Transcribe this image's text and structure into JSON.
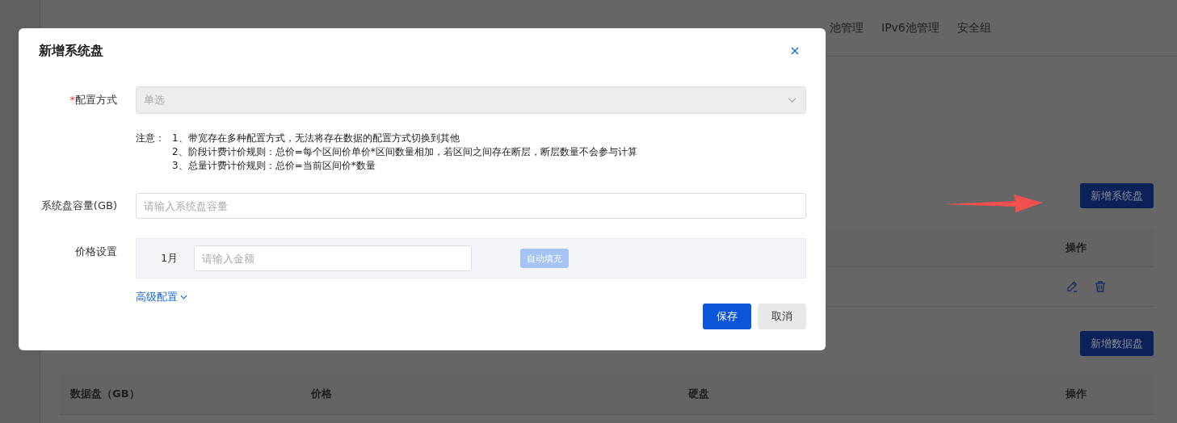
{
  "background": {
    "tabs": [
      {
        "label": "池管理"
      },
      {
        "label": "IPv6池管理"
      },
      {
        "label": "安全组"
      }
    ],
    "system_disk": {
      "add_button": "新增系统盘",
      "columns": [
        "",
        "",
        "",
        "操作"
      ]
    },
    "data_disk": {
      "add_button": "新增数据盘",
      "columns": [
        "数据盘（GB）",
        "价格",
        "硬盘",
        "操作"
      ]
    }
  },
  "annotation": {
    "kind": "arrow"
  },
  "dialog": {
    "title": "新增系统盘",
    "config_method": {
      "label": "配置方式",
      "required_mark": "*",
      "value": "单选",
      "disabled": true
    },
    "notice": {
      "label": "注意：",
      "lines": [
        "1、带宽存在多种配置方式，无法将存在数据的配置方式切换到其他",
        "2、阶段计费计价规则：总价=每个区间价单价*区间数量相加，若区间之间存在断层，断层数量不会参与计算",
        "3、总量计费计价规则：总价=当前区间价*数量"
      ]
    },
    "capacity": {
      "label": "系统盘容量(GB)",
      "placeholder": "请输入系统盘容量"
    },
    "price": {
      "label": "价格设置",
      "period": "1月",
      "placeholder": "请输入金额",
      "autofill_button": {
        "label": "自动填充",
        "disabled": true
      }
    },
    "advanced_link": "高级配置",
    "buttons": [
      {
        "label": "保存",
        "kind": "primary"
      },
      {
        "label": "取消",
        "kind": "secondary"
      }
    ]
  }
}
